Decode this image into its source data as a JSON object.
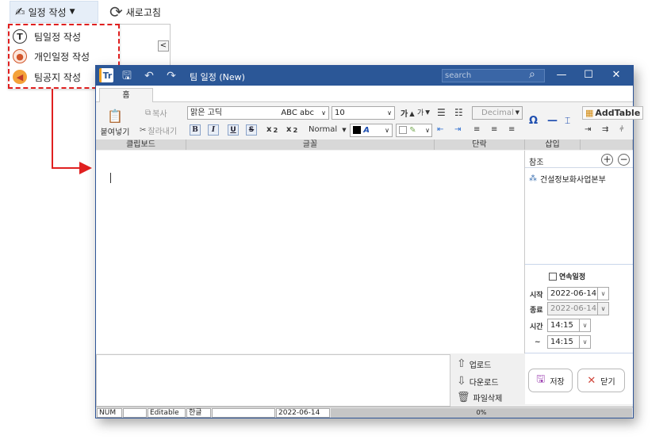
{
  "app_toolbar": {
    "write_label": "일정 작성",
    "refresh_label": "새로고침"
  },
  "dropdown": {
    "items": [
      {
        "label": "팀일정 작성",
        "icon": "team-t-icon"
      },
      {
        "label": "개인일정 작성",
        "icon": "person-icon"
      },
      {
        "label": "팀공지 작성",
        "icon": "megaphone-icon"
      }
    ]
  },
  "window": {
    "logo_text": "Tr",
    "title": "팀 일정 (New)",
    "search_placeholder": "search",
    "controls": {
      "minimize": "—",
      "maximize": "☐",
      "close": "✕"
    }
  },
  "ribbon": {
    "tab": "홈",
    "paste": "붙여넣기",
    "copy": "복사",
    "cut": "잘라내기",
    "font_name": "맑은 고딕",
    "font_preview": "ABC abc",
    "font_size": "10",
    "style_normal": "Normal",
    "list_style": "Decimal",
    "add_table": "AddTable",
    "groups": {
      "clipboard": "클립보드",
      "font": "글꼴",
      "paragraph": "단락",
      "insert": "삽입"
    }
  },
  "side": {
    "ref_title": "참조",
    "ref_item": "건설정보화사업본부",
    "continuous_label": "연속일정",
    "start_label": "시작",
    "start_date": "2022-06-14",
    "end_label": "종료",
    "end_date": "2022-06-14",
    "time_label": "시간",
    "time_start": "14:15",
    "tilde": "~",
    "time_end": "14:15"
  },
  "attach": {
    "upload": "업로드",
    "download": "다운로드",
    "delete": "파일삭제"
  },
  "buttons": {
    "save": "저장",
    "close": "닫기"
  },
  "status": {
    "num": "NUM",
    "blank1": "",
    "editable": "Editable",
    "lang": "한글",
    "blank2": "",
    "date": "2022-06-14",
    "progress": "0%"
  },
  "colors": {
    "titlebar": "#2b5797",
    "highlight": "#e02020"
  }
}
